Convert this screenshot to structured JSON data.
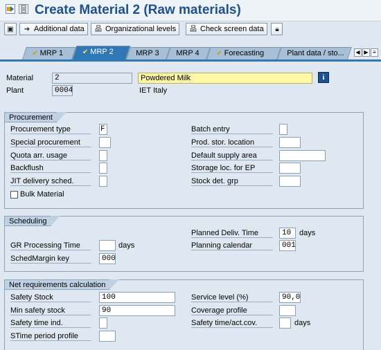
{
  "window": {
    "title": "Create Material 2 (Raw materials)"
  },
  "toolbar": {
    "additional_data": "Additional data",
    "org_levels": "Organizational levels",
    "check_screen_data": "Check screen data"
  },
  "tabs": [
    {
      "label": "MRP 1",
      "icon": "check-icon",
      "active": false
    },
    {
      "label": "MRP 2",
      "icon": "check-icon",
      "active": true
    },
    {
      "label": "MRP 3",
      "icon": "",
      "active": false
    },
    {
      "label": "MRP 4",
      "icon": "check-icon",
      "active": false
    },
    {
      "label": "Forecasting",
      "icon": "check-icon",
      "active": false
    },
    {
      "label": "Plant data / sto...",
      "icon": "",
      "active": false
    }
  ],
  "header": {
    "material_label": "Material",
    "material_value": "2",
    "material_desc": "Powdered Milk",
    "plant_label": "Plant",
    "plant_value": "0004",
    "plant_desc": "IET Italy"
  },
  "procurement": {
    "title": "Procurement",
    "procurement_type_label": "Procurement type",
    "procurement_type_value": "F",
    "special_procurement_label": "Special procurement",
    "special_procurement_value": "",
    "quota_arr_label": "Quota arr. usage",
    "quota_arr_value": "",
    "backflush_label": "Backflush",
    "backflush_value": "",
    "jit_label": "JIT delivery sched.",
    "jit_value": "",
    "bulk_material_label": "Bulk Material",
    "bulk_material_checked": false,
    "batch_entry_label": "Batch entry",
    "batch_entry_value": "",
    "prod_stor_label": "Prod. stor. location",
    "prod_stor_value": "",
    "default_supply_label": "Default supply area",
    "default_supply_value": "",
    "storage_loc_ep_label": "Storage loc. for EP",
    "storage_loc_ep_value": "",
    "stock_det_label": "Stock det. grp",
    "stock_det_value": ""
  },
  "scheduling": {
    "title": "Scheduling",
    "gr_processing_label": "GR Processing Time",
    "gr_processing_value": "",
    "gr_processing_unit": "days",
    "schedmargin_label": "SchedMargin key",
    "schedmargin_value": "000",
    "planned_deliv_label": "Planned Deliv. Time",
    "planned_deliv_value": "10",
    "planned_deliv_unit": "days",
    "planning_calendar_label": "Planning calendar",
    "planning_calendar_value": "001"
  },
  "net_requirements": {
    "title": "Net requirements calculation",
    "safety_stock_label": "Safety Stock",
    "safety_stock_value": "100",
    "min_safety_label": "Min safety stock",
    "min_safety_value": "90",
    "safety_time_ind_label": "Safety time ind.",
    "safety_time_ind_value": "",
    "stime_period_label": "STime period profile",
    "stime_period_value": "",
    "service_level_label": "Service level (%)",
    "service_level_value": "90,0",
    "coverage_label": "Coverage profile",
    "coverage_value": "",
    "safety_time_act_label": "Safety time/act.cov.",
    "safety_time_act_value": "",
    "safety_time_act_unit": "days"
  }
}
